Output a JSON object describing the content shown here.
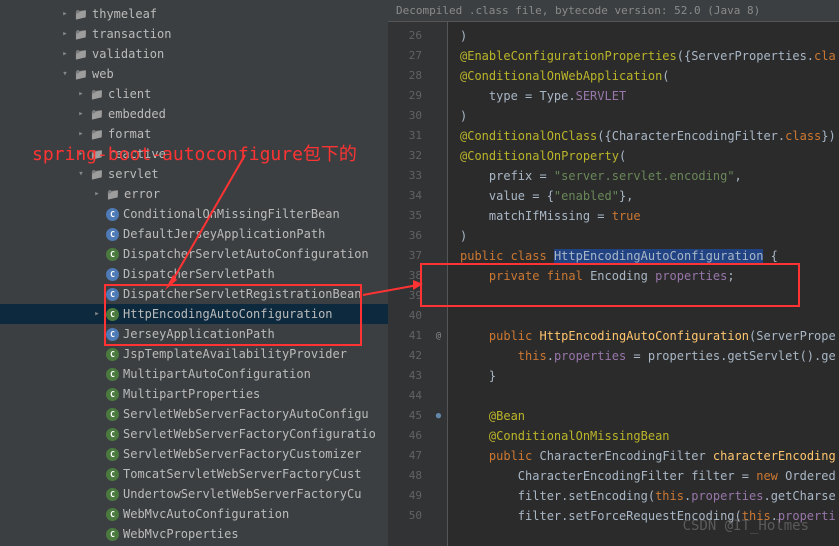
{
  "annotation": {
    "text": "spring-boot-autoconfigure包下的"
  },
  "watermark": "CSDN @IT_Holmes",
  "tree": {
    "items": [
      {
        "indent": 1,
        "chevron": "right",
        "icon": "folder",
        "label": "thymeleaf"
      },
      {
        "indent": 1,
        "chevron": "right",
        "icon": "folder",
        "label": "transaction"
      },
      {
        "indent": 1,
        "chevron": "right",
        "icon": "folder",
        "label": "validation"
      },
      {
        "indent": 1,
        "chevron": "down",
        "icon": "folder",
        "label": "web"
      },
      {
        "indent": 2,
        "chevron": "right",
        "icon": "folder",
        "label": "client"
      },
      {
        "indent": 2,
        "chevron": "right",
        "icon": "folder",
        "label": "embedded"
      },
      {
        "indent": 2,
        "chevron": "right",
        "icon": "folder",
        "label": "format"
      },
      {
        "indent": 2,
        "chevron": "right",
        "icon": "folder",
        "label": "reactive"
      },
      {
        "indent": 2,
        "chevron": "down",
        "icon": "folder",
        "label": "servlet"
      },
      {
        "indent": 3,
        "chevron": "right",
        "icon": "folder",
        "label": "error"
      },
      {
        "indent": 3,
        "chevron": "none",
        "icon": "class",
        "label": "ConditionalOnMissingFilterBean"
      },
      {
        "indent": 3,
        "chevron": "none",
        "icon": "class",
        "label": "DefaultJerseyApplicationPath"
      },
      {
        "indent": 3,
        "chevron": "none",
        "icon": "class",
        "label": "DispatcherServletAutoConfiguration"
      },
      {
        "indent": 3,
        "chevron": "none",
        "icon": "class",
        "label": "DispatcherServletPath"
      },
      {
        "indent": 3,
        "chevron": "none",
        "icon": "class",
        "label": "DispatcherServletRegistrationBean"
      },
      {
        "indent": 3,
        "chevron": "right",
        "icon": "class",
        "label": "HttpEncodingAutoConfiguration",
        "selected": true
      },
      {
        "indent": 3,
        "chevron": "none",
        "icon": "class",
        "label": "JerseyApplicationPath"
      },
      {
        "indent": 3,
        "chevron": "none",
        "icon": "class",
        "label": "JspTemplateAvailabilityProvider"
      },
      {
        "indent": 3,
        "chevron": "none",
        "icon": "class",
        "label": "MultipartAutoConfiguration"
      },
      {
        "indent": 3,
        "chevron": "none",
        "icon": "class",
        "label": "MultipartProperties"
      },
      {
        "indent": 3,
        "chevron": "none",
        "icon": "class",
        "label": "ServletWebServerFactoryAutoConfigu"
      },
      {
        "indent": 3,
        "chevron": "none",
        "icon": "class",
        "label": "ServletWebServerFactoryConfiguratio"
      },
      {
        "indent": 3,
        "chevron": "none",
        "icon": "class",
        "label": "ServletWebServerFactoryCustomizer"
      },
      {
        "indent": 3,
        "chevron": "none",
        "icon": "class",
        "label": "TomcatServletWebServerFactoryCust"
      },
      {
        "indent": 3,
        "chevron": "none",
        "icon": "class",
        "label": "UndertowServletWebServerFactoryCu"
      },
      {
        "indent": 3,
        "chevron": "none",
        "icon": "class",
        "label": "WebMvcAutoConfiguration"
      },
      {
        "indent": 3,
        "chevron": "none",
        "icon": "class",
        "label": "WebMvcProperties"
      }
    ]
  },
  "editor": {
    "header": "Decompiled .class file, bytecode version: 52.0 (Java 8)",
    "lines": [
      {
        "num": 26,
        "html": ")"
      },
      {
        "num": 27,
        "html": "<span class='c-annotation'>@EnableConfigurationProperties</span>({<span class='c-classname'>ServerProperties</span>.<span class='c-keyword'>cla</span>"
      },
      {
        "num": 28,
        "html": "<span class='c-annotation'>@ConditionalOnWebApplication</span>("
      },
      {
        "num": 29,
        "html": "    type = Type.<span class='c-field'>SERVLET</span>"
      },
      {
        "num": 30,
        "html": ")"
      },
      {
        "num": 31,
        "html": "<span class='c-annotation'>@ConditionalOnClass</span>({<span class='c-classname'>CharacterEncodingFilter</span>.<span class='c-keyword'>class</span>})"
      },
      {
        "num": 32,
        "html": "<span class='c-annotation'>@ConditionalOnProperty</span>("
      },
      {
        "num": 33,
        "html": "    prefix = <span class='c-string'>\"server.servlet.encoding\"</span>,"
      },
      {
        "num": 34,
        "html": "    value = {<span class='c-string'>\"enabled\"</span>},"
      },
      {
        "num": 35,
        "html": "    matchIfMissing = <span class='c-keyword'>true</span>"
      },
      {
        "num": 36,
        "html": ")"
      },
      {
        "num": 37,
        "html": "<span class='c-keyword'>public class</span> <span class='highlight-sel'>HttpEncodingAutoConfiguration</span> {"
      },
      {
        "num": 38,
        "html": "    <span class='c-keyword'>private final</span> <span class='c-classname'>Encoding</span> <span class='c-field'>properties</span>;"
      },
      {
        "num": 39,
        "html": ""
      },
      {
        "num": "",
        "html": ""
      },
      {
        "num": 40,
        "html": "    <span class='c-keyword'>public</span> <span class='c-method'>HttpEncodingAutoConfiguration</span>(<span class='c-classname'>ServerPrope</span>"
      },
      {
        "num": 41,
        "html": "        <span class='c-keyword'>this</span>.<span class='c-field'>properties</span> = properties.getServlet().ge"
      },
      {
        "num": 42,
        "html": "    }"
      },
      {
        "num": 43,
        "html": ""
      },
      {
        "num": 44,
        "html": "    <span class='c-annotation'>@Bean</span>"
      },
      {
        "num": 45,
        "html": "    <span class='c-annotation'>@ConditionalOnMissingBean</span>"
      },
      {
        "num": 46,
        "html": "    <span class='c-keyword'>public</span> <span class='c-classname'>CharacterEncodingFilter</span> <span class='c-method'>characterEncoding</span>"
      },
      {
        "num": 47,
        "html": "        <span class='c-classname'>CharacterEncodingFilter</span> filter = <span class='c-keyword'>new</span> <span class='c-classname'>Ordered</span>"
      },
      {
        "num": 48,
        "html": "        filter.setEncoding(<span class='c-keyword'>this</span>.<span class='c-field'>properties</span>.getCharse"
      },
      {
        "num": 49,
        "html": "        filter.setForceRequestEncoding(<span class='c-keyword'>this</span>.<span class='c-field'>properti</span>"
      },
      {
        "num": 50,
        "html": ""
      }
    ]
  }
}
